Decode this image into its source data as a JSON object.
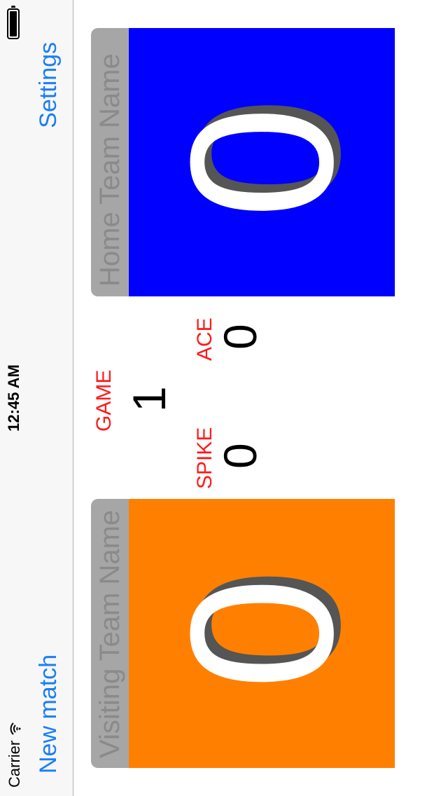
{
  "status_bar": {
    "carrier": "Carrier",
    "time": "12:45 AM",
    "wifi_icon": "wifi-icon",
    "battery_icon": "battery-icon"
  },
  "nav": {
    "left_button": "New match",
    "right_button": "Settings",
    "accent_color": "#1a7ef5"
  },
  "visiting_team": {
    "name_placeholder": "Visiting Team Name",
    "score": "0",
    "color": "#ff8000"
  },
  "home_team": {
    "name_placeholder": "Home Team Name",
    "score": "0",
    "color": "#0000fe"
  },
  "stats": {
    "game_label": "GAME",
    "game_value": "1",
    "spike_label": "SPIKE",
    "spike_value": "0",
    "ace_label": "ACE",
    "ace_value": "0",
    "label_color": "#ff1a1a"
  }
}
